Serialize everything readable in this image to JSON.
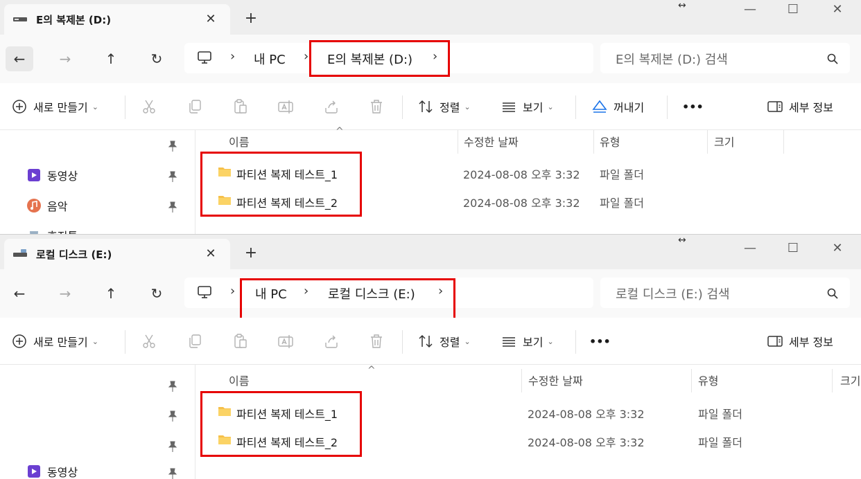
{
  "colors": {
    "accent": "#e60000",
    "folder": "#f6c04a",
    "selected_tab": "#f9f9f9",
    "tabstrip": "#eeeeee"
  },
  "window_controls": {
    "resize_hint": "↔",
    "minimize": "—",
    "maximize": "☐",
    "close": "✕"
  },
  "toolbar": {
    "new": "새로 만들기",
    "sort": "정렬",
    "view": "보기",
    "eject": "꺼내기",
    "more": "•••",
    "details": "세부 정보",
    "icons": [
      "plus-circle-icon",
      "cut-icon",
      "copy-icon",
      "paste-icon",
      "rename-icon",
      "share-icon",
      "delete-icon",
      "sort-icon",
      "view-icon",
      "eject-icon",
      "details-pane-icon"
    ]
  },
  "columns": {
    "name": "이름",
    "date": "수정한 날짜",
    "type": "유형",
    "size": "크기",
    "sort_indicator": "^"
  },
  "top_window": {
    "tab_title": "E의 복제본 (D:)",
    "tab_close": "✕",
    "new_tab": "+",
    "breadcrumb": [
      "내 PC",
      "E의 복제본 (D:)"
    ],
    "search_placeholder": "E의 복제본 (D:) 검색",
    "sidebar": [
      {
        "label": "동영상",
        "icon": "video-folder-icon"
      },
      {
        "label": "음악",
        "icon": "music-folder-icon"
      },
      {
        "label": "휴지통",
        "icon": "recycle-bin-icon"
      }
    ],
    "files": [
      {
        "name": "파티션 복제 테스트_1",
        "date": "2024-08-08 오후 3:32",
        "type": "파일 폴더"
      },
      {
        "name": "파티션 복제 테스트_2",
        "date": "2024-08-08 오후 3:32",
        "type": "파일 폴더"
      }
    ]
  },
  "bottom_window": {
    "tab_title": "로컬 디스크 (E:)",
    "tab_close": "✕",
    "new_tab": "+",
    "breadcrumb": [
      "내 PC",
      "로컬 디스크 (E:)"
    ],
    "search_placeholder": "로컬 디스크 (E:) 검색",
    "sidebar": [
      {
        "label": "동영상",
        "icon": "video-folder-icon"
      }
    ],
    "files": [
      {
        "name": "파티션 복제 테스트_1",
        "date": "2024-08-08 오후 3:32",
        "type": "파일 폴더"
      },
      {
        "name": "파티션 복제 테스트_2",
        "date": "2024-08-08 오후 3:32",
        "type": "파일 폴더"
      }
    ]
  }
}
